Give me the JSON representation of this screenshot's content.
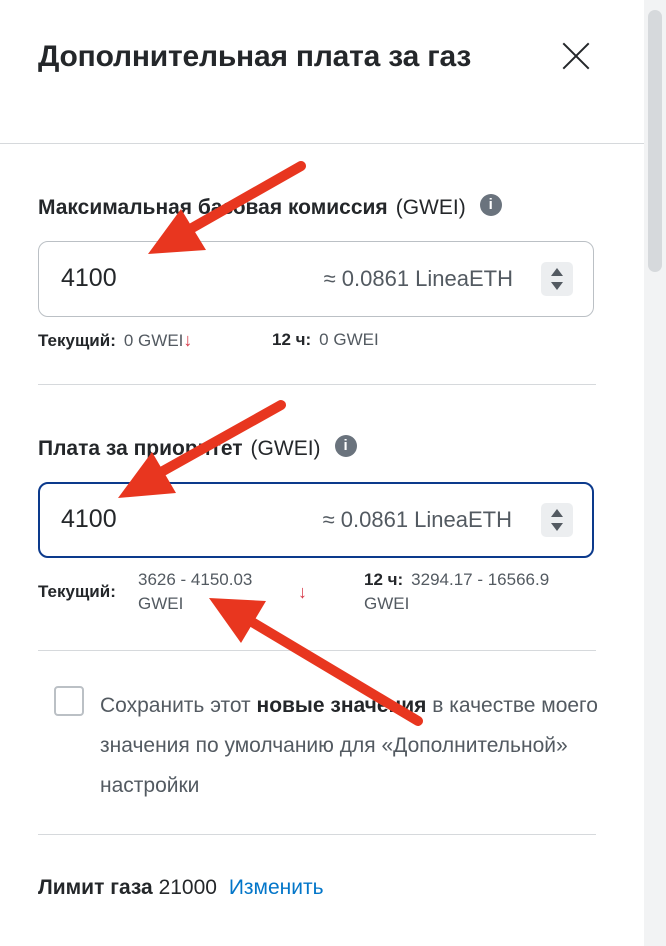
{
  "header": {
    "title": "Дополнительная плата за газ"
  },
  "max_base_fee": {
    "label": "Максимальная базовая комиссия",
    "unit": "(GWEI)",
    "value": "4100",
    "conversion": "≈ 0.0861 LineaETH",
    "current_key": "Текущий:",
    "current_value": "0 GWEI",
    "history_key": "12 ч:",
    "history_value": "0 GWEI"
  },
  "priority_fee": {
    "label": "Плата за приоритет",
    "unit": "(GWEI)",
    "value": "4100",
    "conversion": "≈ 0.0861 LineaETH",
    "current_key": "Текущий:",
    "current_line1": "3626 - 4150.03",
    "current_line2": "GWEI",
    "history_key": "12 ч:",
    "history_line1": "3294.17 - 16566.9",
    "history_line2": "GWEI"
  },
  "save_default": {
    "text_before": "Сохранить этот",
    "text_bold": "новые значения",
    "text_after": "в качестве моего значения по умолчанию для «Дополнительной» настройки",
    "checked": false
  },
  "gas_limit": {
    "label": "Лимит газа",
    "value": "21000",
    "edit_label": "Изменить"
  },
  "colors": {
    "accent": "#0376c9",
    "focus_border": "#0c3a8c",
    "down_arrow": "#d73847",
    "annotation_arrow": "#e8361f"
  },
  "icons": {
    "info": "info-icon",
    "close": "close-icon",
    "down": "arrow-down-icon",
    "stepper": "stepper-icon"
  }
}
